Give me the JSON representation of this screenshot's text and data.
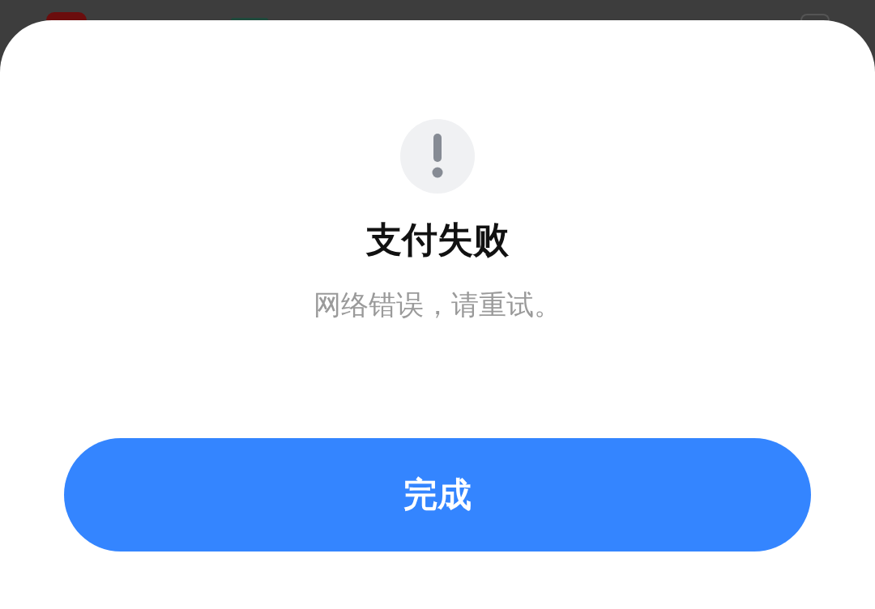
{
  "dialog": {
    "title": "支付失败",
    "message": "网络错误，请重试。",
    "button": "完成"
  }
}
